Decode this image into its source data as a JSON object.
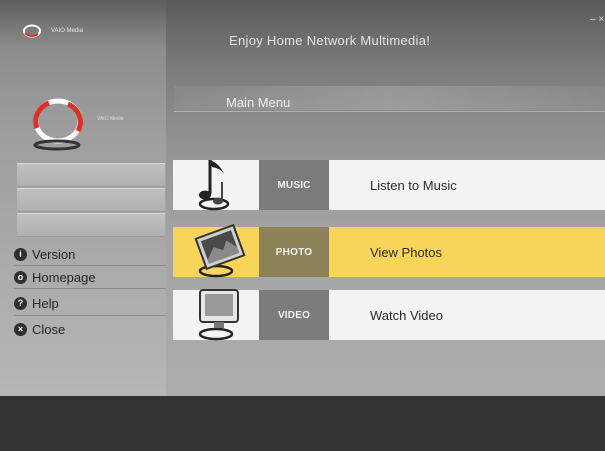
{
  "header": {
    "app_name_small": "VAIO Media",
    "title": "Enjoy Home Network Multimedia!",
    "window_controls": "– ×"
  },
  "branding": {
    "app_name_large": "VAIO Media"
  },
  "main": {
    "section_title": "Main Menu",
    "menu_items": [
      {
        "tag": "MUSIC",
        "label": "Listen to Music",
        "icon": "music-note-icon",
        "selected": false
      },
      {
        "tag": "PHOTO",
        "label": "View Photos",
        "icon": "photo-icon",
        "selected": true
      },
      {
        "tag": "VIDEO",
        "label": "Watch Video",
        "icon": "monitor-icon",
        "selected": false
      }
    ]
  },
  "sidebar": {
    "links": [
      {
        "label": "Version",
        "icon": "info-icon",
        "glyph": "i"
      },
      {
        "label": "Homepage",
        "icon": "home-icon",
        "glyph": "o"
      },
      {
        "label": "Help",
        "icon": "help-icon",
        "glyph": "?"
      },
      {
        "label": "Close",
        "icon": "close-icon",
        "glyph": "×"
      }
    ]
  },
  "colors": {
    "selected_row": "#f8d558",
    "row_background": "#f3f3f3",
    "tag_background": "#7b7b7b",
    "bottom_bar": "#323232",
    "logo_red": "#d8322b"
  }
}
